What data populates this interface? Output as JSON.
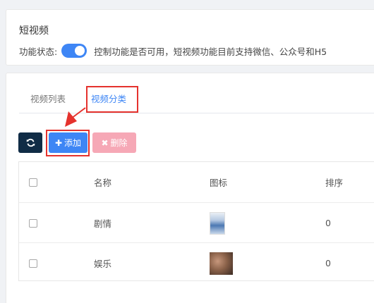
{
  "header": {
    "title": "短视频",
    "status_label": "功能状态:",
    "status_desc": "控制功能是否可用，短视频功能目前支持微信、公众号和H5",
    "toggle_on": true
  },
  "tabs": [
    {
      "label": "视频列表",
      "active": false
    },
    {
      "label": "视频分类",
      "active": true
    }
  ],
  "toolbar": {
    "refresh_icon": "refresh-icon",
    "add_label": "添加",
    "delete_label": "删除"
  },
  "table": {
    "columns": [
      "名称",
      "图标",
      "排序"
    ],
    "rows": [
      {
        "name": "剧情",
        "order": "0"
      },
      {
        "name": "娱乐",
        "order": "0"
      }
    ]
  },
  "colors": {
    "accent": "#3e86f5",
    "refresh_btn": "#102c46",
    "delete_btn": "#f6a8b6",
    "highlight": "#e5322d"
  }
}
